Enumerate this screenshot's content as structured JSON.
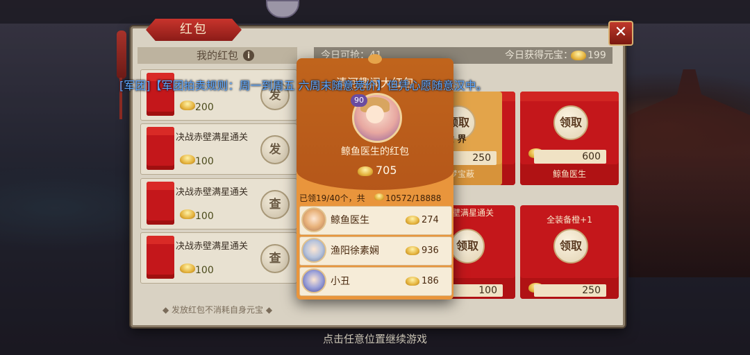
{
  "panel": {
    "title": "红包",
    "close_icon": "close-x"
  },
  "my_packets": {
    "header": "我的红包",
    "info_icon": "i",
    "footer": "发放红包不消耗自身元宝",
    "items": [
      {
        "title": "",
        "amount": "200",
        "action": "发"
      },
      {
        "title": "决战赤壁满星通关",
        "amount": "100",
        "action": "发"
      },
      {
        "title": "决战赤壁满星通关",
        "amount": "100",
        "action": "查"
      },
      {
        "title": "决战赤壁满星通关",
        "amount": "100",
        "action": "查"
      }
    ]
  },
  "right": {
    "today_can_label": "今日可抢：41",
    "today_got_label": "今日获得元宝：",
    "today_got_value": "199",
    "cards": [
      {
        "title": "",
        "claim": "领取",
        "amount": "",
        "sender": ""
      },
      {
        "title": "",
        "claim": "领取",
        "amount": "250",
        "sender": "梦宝蔽"
      },
      {
        "title": "",
        "claim": "领取",
        "amount": "600",
        "sender": "鲸鱼医生"
      },
      {
        "title": "",
        "claim": "领取",
        "amount": "",
        "sender": ""
      },
      {
        "title": "壁满星通关",
        "claim": "领取",
        "amount": "100",
        "sender": ""
      },
      {
        "title": "全装备橙+1",
        "claim": "领取",
        "amount": "250",
        "sender": ""
      }
    ],
    "card_extra_text": "世 界"
  },
  "overlay": {
    "title": "清河趣闻大红包",
    "level": "90",
    "sender": "鲸鱼医生的红包",
    "amount": "705",
    "summary_left": "已领19/40个，共",
    "summary_right": "10572/18888",
    "rows": [
      {
        "name": "鲸鱼医生",
        "amount": "274"
      },
      {
        "name": "渔阳徐素娴",
        "amount": "936"
      },
      {
        "name": "小丑",
        "amount": "186"
      }
    ]
  },
  "notice": "[军团]【军团拍卖规则：周一到周五                                          六周末随意竞价】但凭心愿随意汉中。",
  "continue_hint": "点击任意位置继续游戏",
  "colors": {
    "red_packet": "#c4171b",
    "overlay_orange": "#e9953c",
    "notice_blue": "#5fa8ff"
  }
}
